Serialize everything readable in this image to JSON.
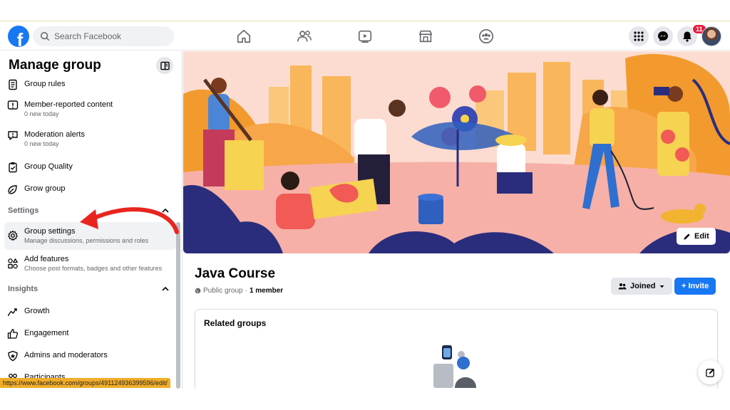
{
  "nav": {
    "search_placeholder": "Search Facebook",
    "notifications_count": "11",
    "logo_letter": "f"
  },
  "sidebar": {
    "title": "Manage group",
    "items_top": [
      {
        "label": "Group rules",
        "sub": "",
        "icon": "rules-icon"
      },
      {
        "label": "Member-reported content",
        "sub": "0 new today",
        "icon": "report-icon"
      },
      {
        "label": "Moderation alerts",
        "sub": "0 new today",
        "icon": "alert-icon"
      },
      {
        "label": "Group Quality",
        "sub": "",
        "icon": "quality-icon"
      },
      {
        "label": "Grow group",
        "sub": "",
        "icon": "grow-icon"
      }
    ],
    "settings_section": "Settings",
    "settings_items": [
      {
        "label": "Group settings",
        "sub": "Manage discussions, permissions and roles",
        "icon": "gear-icon"
      },
      {
        "label": "Add features",
        "sub": "Choose post formats, badges and other features",
        "icon": "features-icon"
      }
    ],
    "insights_section": "Insights",
    "insights_items": [
      {
        "label": "Growth",
        "icon": "growth-icon"
      },
      {
        "label": "Engagement",
        "icon": "thumbs-up-icon"
      },
      {
        "label": "Admins and moderators",
        "icon": "shield-icon"
      },
      {
        "label": "Participants",
        "icon": "participants-icon"
      }
    ]
  },
  "status_url": "https://www.facebook.com/groups/491124936399596/edit/",
  "main": {
    "edit_label": "Edit",
    "group_name": "Java Course",
    "privacy": "Public group",
    "separator": "·",
    "members": "1 member",
    "joined_label": "Joined",
    "invite_label": "+ Invite",
    "related_title": "Related groups"
  },
  "colors": {
    "brand_blue": "#1877f2",
    "badge_red": "#e41e3f",
    "arrow_red": "#e8251f",
    "status_bar_orange": "#f1ad2a"
  }
}
